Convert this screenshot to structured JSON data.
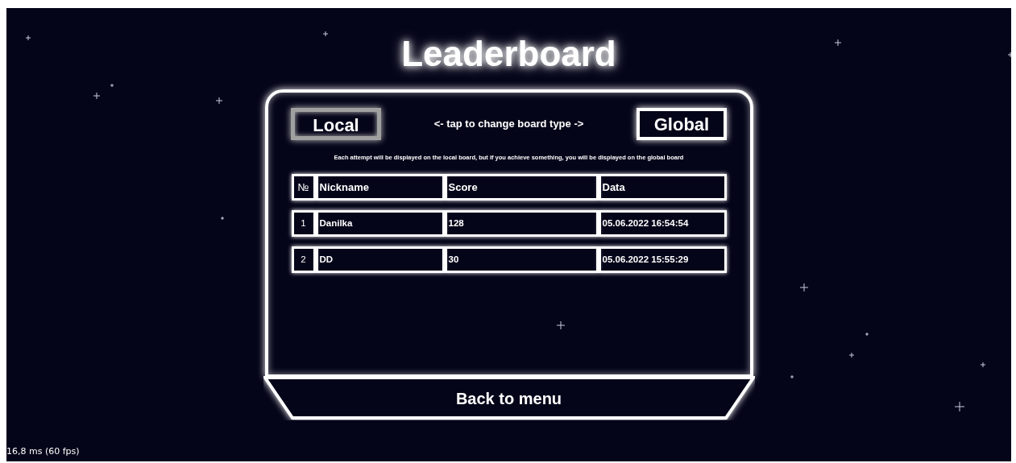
{
  "title": "Leaderboard",
  "board_tabs": [
    {
      "label": "Local",
      "selected": true
    },
    {
      "label": "Global",
      "selected": false
    }
  ],
  "tap_hint": "<- tap to change board type ->",
  "description": "Each attempt will be displayed on the local board, but if you achieve something, you will be displayed on the global board",
  "table": {
    "columns": [
      "№",
      "Nickname",
      "Score",
      "Data"
    ],
    "rows": [
      [
        "1",
        "Danilka",
        "128",
        "05.06.2022 16:54:54"
      ],
      [
        "2",
        "DD",
        "30",
        "05.06.2022 15:55:29"
      ]
    ]
  },
  "back_button": "Back to menu",
  "frame_time": "16,8 ms (60 fps)"
}
